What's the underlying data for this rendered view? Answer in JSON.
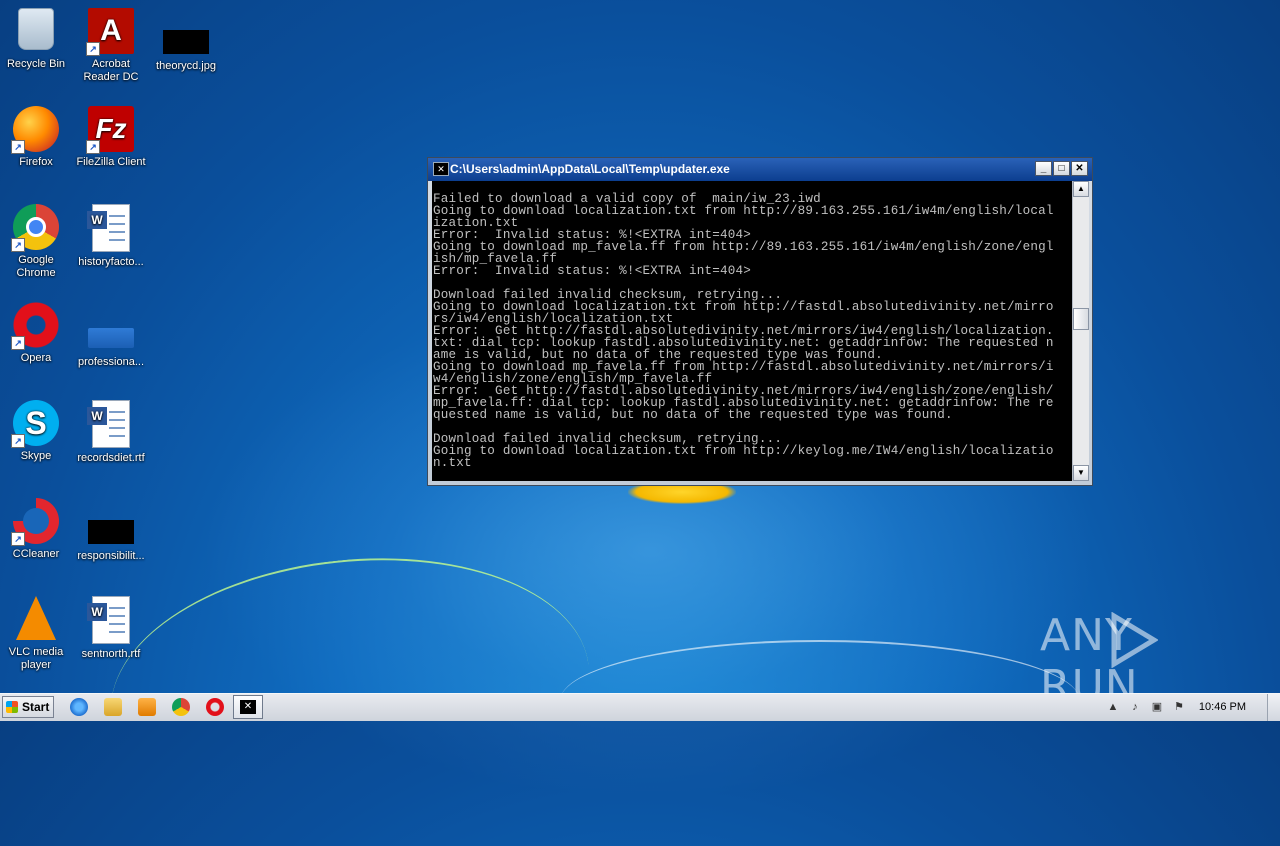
{
  "desktop": {
    "icons": [
      {
        "label": "Recycle Bin",
        "icon": "recycle-bin-icon"
      },
      {
        "label": "Acrobat Reader DC",
        "icon": "acrobat-reader-icon"
      },
      {
        "label": "theorycd.jpg",
        "icon": "image-file-icon"
      },
      {
        "label": "Firefox",
        "icon": "firefox-icon"
      },
      {
        "label": "FileZilla Client",
        "icon": "filezilla-icon"
      },
      {
        "label": "Google Chrome",
        "icon": "chrome-icon"
      },
      {
        "label": "historyfacto...",
        "icon": "word-doc-icon"
      },
      {
        "label": "Opera",
        "icon": "opera-icon"
      },
      {
        "label": "professiona...",
        "icon": "folder-icon"
      },
      {
        "label": "Skype",
        "icon": "skype-icon"
      },
      {
        "label": "recordsdiet.rtf",
        "icon": "word-doc-icon"
      },
      {
        "label": "CCleaner",
        "icon": "ccleaner-icon"
      },
      {
        "label": "responsibilit...",
        "icon": "image-file-icon"
      },
      {
        "label": "VLC media player",
        "icon": "vlc-icon"
      },
      {
        "label": "sentnorth.rtf",
        "icon": "word-doc-icon"
      }
    ]
  },
  "console": {
    "title": "C:\\Users\\admin\\AppData\\Local\\Temp\\updater.exe",
    "buttons": {
      "minimize": "_",
      "maximize": "□",
      "close": "✕"
    },
    "lines": [
      "Failed to download a valid copy of  main/iw_23.iwd",
      "Going to download localization.txt from http://89.163.255.161/iw4m/english/local",
      "ization.txt",
      "Error:  Invalid status: %!<EXTRA int=404>",
      "Going to download mp_favela.ff from http://89.163.255.161/iw4m/english/zone/engl",
      "ish/mp_favela.ff",
      "Error:  Invalid status: %!<EXTRA int=404>",
      "",
      "Download failed invalid checksum, retrying...",
      "Going to download localization.txt from http://fastdl.absolutedivinity.net/mirro",
      "rs/iw4/english/localization.txt",
      "Error:  Get http://fastdl.absolutedivinity.net/mirrors/iw4/english/localization.",
      "txt: dial tcp: lookup fastdl.absolutedivinity.net: getaddrinfow: The requested n",
      "ame is valid, but no data of the requested type was found.",
      "Going to download mp_favela.ff from http://fastdl.absolutedivinity.net/mirrors/i",
      "w4/english/zone/english/mp_favela.ff",
      "Error:  Get http://fastdl.absolutedivinity.net/mirrors/iw4/english/zone/english/",
      "mp_favela.ff: dial tcp: lookup fastdl.absolutedivinity.net: getaddrinfow: The re",
      "quested name is valid, but no data of the requested type was found.",
      "",
      "Download failed invalid checksum, retrying...",
      "Going to download localization.txt from http://keylog.me/IW4/english/localizatio",
      "n.txt"
    ]
  },
  "taskbar": {
    "start_label": "Start",
    "pinned": [
      "internet-explorer-icon",
      "explorer-folder-icon",
      "media-player-icon",
      "chrome-icon",
      "opera-icon"
    ],
    "active_window_icon": "console-icon",
    "clock": "10:46 PM"
  },
  "watermark": {
    "text_left": "ANY",
    "text_right": "RUN"
  }
}
